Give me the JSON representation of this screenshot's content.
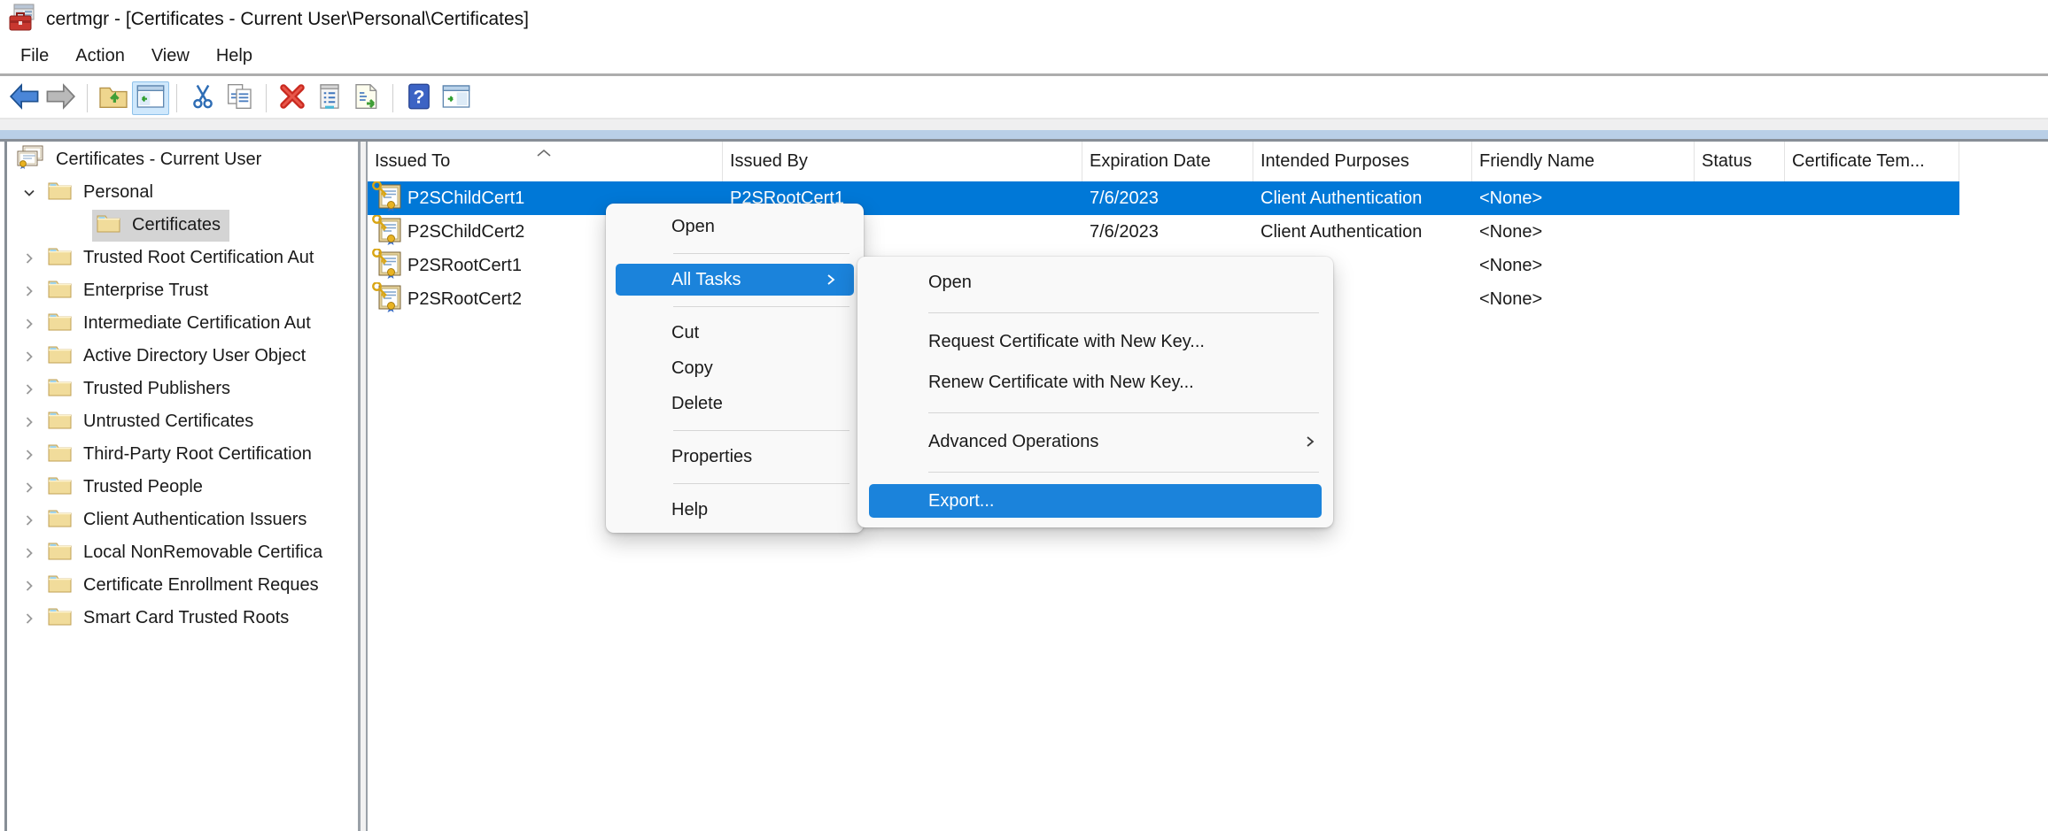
{
  "window": {
    "title": "certmgr - [Certificates - Current User\\Personal\\Certificates]"
  },
  "menu_bar": {
    "items": [
      {
        "label": "File"
      },
      {
        "label": "Action"
      },
      {
        "label": "View"
      },
      {
        "label": "Help"
      }
    ]
  },
  "toolbar": {
    "buttons": [
      {
        "name": "back"
      },
      {
        "name": "forward"
      },
      {
        "name": "up-one-level"
      },
      {
        "name": "show-hide-console-tree",
        "active": true
      },
      {
        "name": "cut"
      },
      {
        "name": "copy"
      },
      {
        "name": "delete"
      },
      {
        "name": "properties"
      },
      {
        "name": "export-list"
      },
      {
        "name": "help"
      },
      {
        "name": "show-hide-action-pane"
      }
    ]
  },
  "tree": {
    "root": {
      "label": "Certificates - Current User"
    },
    "items": [
      {
        "label": "Personal",
        "state": "expanded"
      },
      {
        "label": "Certificates",
        "selected": true
      },
      {
        "label": "Trusted Root Certification Aut",
        "state": "collapsed"
      },
      {
        "label": "Enterprise Trust",
        "state": "collapsed"
      },
      {
        "label": "Intermediate Certification Aut",
        "state": "collapsed"
      },
      {
        "label": "Active Directory User Object",
        "state": "collapsed"
      },
      {
        "label": "Trusted Publishers",
        "state": "collapsed"
      },
      {
        "label": "Untrusted Certificates",
        "state": "collapsed"
      },
      {
        "label": "Third-Party Root Certification",
        "state": "collapsed"
      },
      {
        "label": "Trusted People",
        "state": "collapsed"
      },
      {
        "label": "Client Authentication Issuers",
        "state": "collapsed"
      },
      {
        "label": "Local NonRemovable Certifica",
        "state": "collapsed"
      },
      {
        "label": "Certificate Enrollment Reques",
        "state": "collapsed"
      },
      {
        "label": "Smart Card Trusted Roots",
        "state": "collapsed"
      }
    ]
  },
  "list": {
    "columns": [
      {
        "label": "Issued To",
        "sort": "ascending"
      },
      {
        "label": "Issued By"
      },
      {
        "label": "Expiration Date"
      },
      {
        "label": "Intended Purposes"
      },
      {
        "label": "Friendly Name"
      },
      {
        "label": "Status"
      },
      {
        "label": "Certificate Tem..."
      }
    ],
    "rows": [
      {
        "selected": true,
        "issued_to": "P2SChildCert1",
        "issued_by": "P2SRootCert1",
        "expiration_date": "7/6/2023",
        "intended_purposes": "Client Authentication",
        "friendly_name": "<None>",
        "status": "",
        "certificate_template": ""
      },
      {
        "selected": false,
        "issued_to": "P2SChildCert2",
        "issued_by": "",
        "expiration_date": "7/6/2023",
        "intended_purposes": "Client Authentication",
        "friendly_name": "<None>",
        "status": "",
        "certificate_template": ""
      },
      {
        "selected": false,
        "issued_to": "P2SRootCert1",
        "issued_by": "",
        "expiration_date": "",
        "intended_purposes": "",
        "friendly_name": "<None>",
        "status": "",
        "certificate_template": ""
      },
      {
        "selected": false,
        "issued_to": "P2SRootCert2",
        "issued_by": "",
        "expiration_date": "",
        "intended_purposes": "",
        "friendly_name": "<None>",
        "status": "",
        "certificate_template": ""
      }
    ]
  },
  "context_menu": {
    "items": [
      {
        "label": "Open"
      },
      {
        "type": "separator"
      },
      {
        "label": "All Tasks",
        "highlighted": true,
        "has_submenu": true
      },
      {
        "type": "separator"
      },
      {
        "label": "Cut"
      },
      {
        "label": "Copy"
      },
      {
        "label": "Delete"
      },
      {
        "type": "separator"
      },
      {
        "label": "Properties"
      },
      {
        "type": "separator"
      },
      {
        "label": "Help"
      }
    ]
  },
  "submenu": {
    "items": [
      {
        "label": "Open"
      },
      {
        "type": "separator"
      },
      {
        "label": "Request Certificate with New Key..."
      },
      {
        "label": "Renew Certificate with New Key..."
      },
      {
        "type": "separator"
      },
      {
        "label": "Advanced Operations",
        "has_submenu": true
      },
      {
        "type": "separator"
      },
      {
        "label": "Export...",
        "highlighted": true
      }
    ]
  },
  "colors": {
    "selection_blue": "#0078d7",
    "menu_highlight_blue": "#1b83db",
    "band_blue": "#b9cfe7",
    "inactive_selection_gray": "#d4d4d4"
  }
}
